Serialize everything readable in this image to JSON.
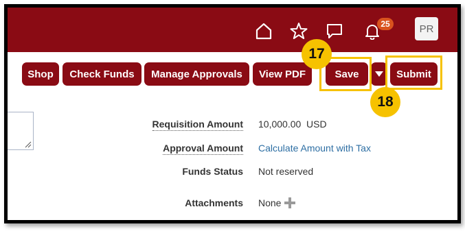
{
  "header": {
    "notification_count": "25",
    "avatar_initials": "PR",
    "icons": [
      "home-icon",
      "star-icon",
      "chat-icon",
      "bell-icon"
    ],
    "brand_color": "#8a0b14"
  },
  "toolbar": {
    "shop_label": "Shop",
    "check_funds_label": "Check Funds",
    "manage_approvals_label": "Manage Approvals",
    "view_pdf_label": "View PDF",
    "save_label": "Save",
    "submit_label": "Submit"
  },
  "callouts": {
    "save_step": "17",
    "submit_step": "18",
    "highlight_color": "#f6c200"
  },
  "fields": {
    "requisition_amount_label": "Requisition Amount",
    "requisition_amount_value": "10,000.00  USD",
    "approval_amount_label": "Approval Amount",
    "approval_amount_value": "Calculate Amount with Tax",
    "funds_status_label": "Funds Status",
    "funds_status_value": "Not reserved",
    "attachments_label": "Attachments",
    "attachments_value": "None"
  }
}
